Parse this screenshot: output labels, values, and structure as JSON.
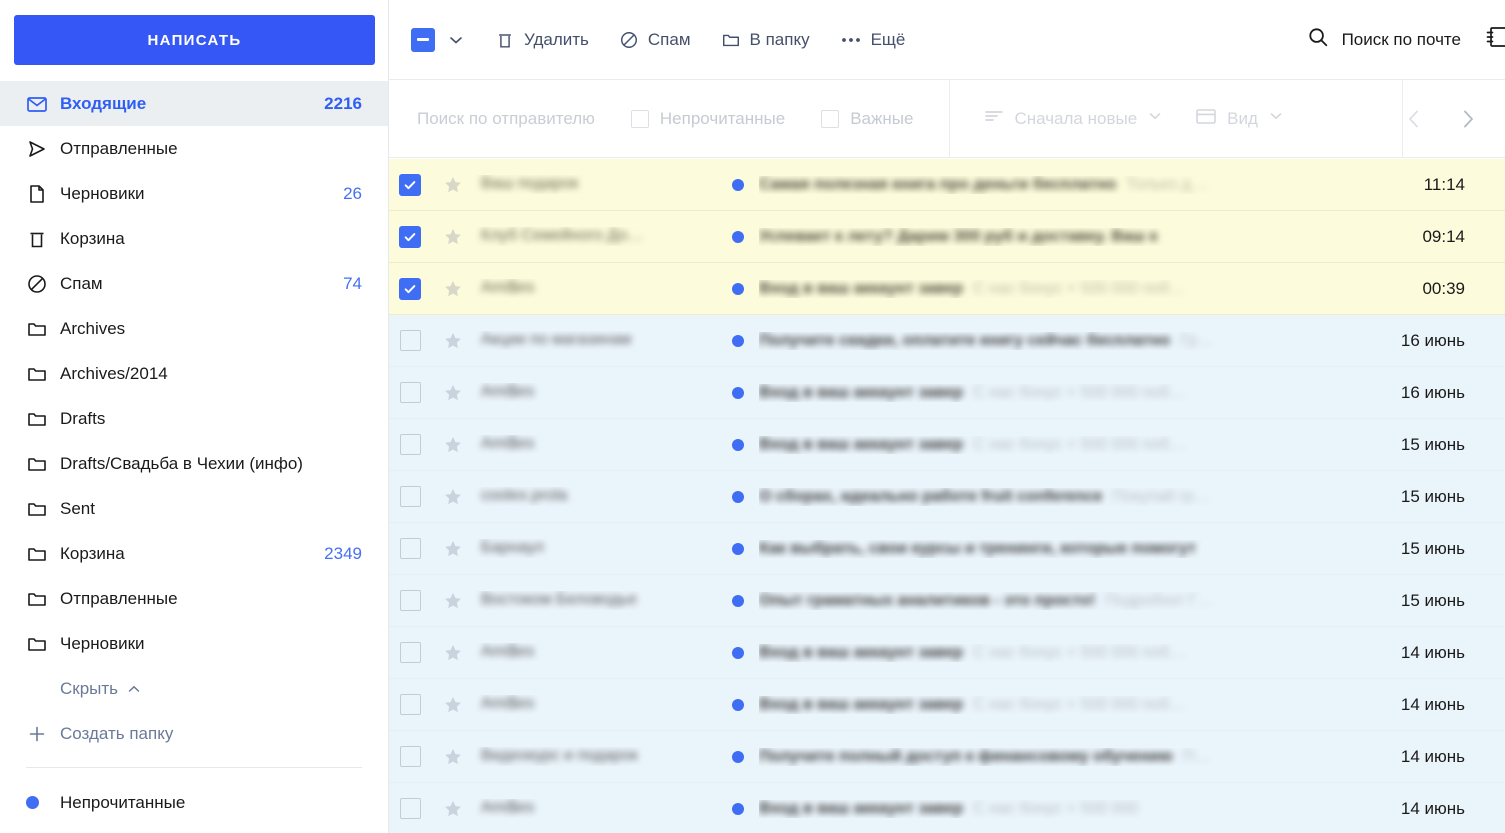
{
  "sidebar": {
    "compose_label": "НАПИСАТЬ",
    "items": [
      {
        "label": "Входящие",
        "count": "2216",
        "icon": "envelope-icon",
        "active": true
      },
      {
        "label": "Отправленные",
        "count": "",
        "icon": "send-icon",
        "active": false
      },
      {
        "label": "Черновики",
        "count": "26",
        "icon": "document-icon",
        "active": false
      },
      {
        "label": "Корзина",
        "count": "",
        "icon": "trash-icon",
        "active": false
      },
      {
        "label": "Спам",
        "count": "74",
        "icon": "block-icon",
        "active": false
      },
      {
        "label": "Archives",
        "count": "",
        "icon": "folder-icon",
        "active": false
      },
      {
        "label": "Archives/2014",
        "count": "",
        "icon": "folder-icon",
        "active": false
      },
      {
        "label": "Drafts",
        "count": "",
        "icon": "folder-icon",
        "active": false
      },
      {
        "label": "Drafts/Свадьба в Чехии (инфо)",
        "count": "",
        "icon": "folder-icon",
        "active": false
      },
      {
        "label": "Sent",
        "count": "",
        "icon": "folder-icon",
        "active": false
      },
      {
        "label": "Корзина",
        "count": "2349",
        "icon": "folder-icon",
        "active": false
      },
      {
        "label": "Отправленные",
        "count": "",
        "icon": "folder-icon",
        "active": false
      },
      {
        "label": "Черновики",
        "count": "",
        "icon": "folder-icon",
        "active": false
      }
    ],
    "hide_label": "Скрыть",
    "create_folder_label": "Создать папку",
    "unread_tag_label": "Непрочитанные"
  },
  "toolbar": {
    "delete_label": "Удалить",
    "spam_label": "Спам",
    "move_label": "В папку",
    "more_label": "Ещё",
    "search_label": "Поиск по почте"
  },
  "filterbar": {
    "sender_placeholder": "Поиск по отправителю",
    "unread_label": "Непрочитанные",
    "important_label": "Важные",
    "sort_label": "Сначала новые",
    "view_label": "Вид"
  },
  "colors": {
    "accent": "#3457f5",
    "link": "#4470f4",
    "selected_row": "#fcfbdc",
    "unread_row": "#eaf4fb",
    "active_nav": "#eceff1"
  },
  "messages": [
    {
      "selected": true,
      "unread": true,
      "from": "Ваш подарок",
      "subject": "Самая полезная книга про деньги бесплатно",
      "preview": "Только д…",
      "date": "11:14"
    },
    {
      "selected": true,
      "unread": true,
      "from": "Клуб Семейного До…",
      "subject": "Успевает к лету? Дарим 300 руб и доставку. Ваш к",
      "preview": "",
      "date": "09:14"
    },
    {
      "selected": true,
      "unread": true,
      "from": "Аmi$еs",
      "subject": "Вход в ваш аккаунт завер",
      "preview": "С нас бонус + 500 000 поб…",
      "date": "00:39"
    },
    {
      "selected": false,
      "unread": true,
      "from": "Акции по магазинам",
      "subject": "Получите скидки, оплатите книгу сейчас бесплатно",
      "preview": "Гр…",
      "date": "16 июнь"
    },
    {
      "selected": false,
      "unread": true,
      "from": "Аmi$еs",
      "subject": "Вход в ваш аккаунт завер",
      "preview": "С нас бонус + 500 000 поб…",
      "date": "16 июнь"
    },
    {
      "selected": false,
      "unread": true,
      "from": "Аmi$еs",
      "subject": "Вход в ваш аккаунт завер",
      "preview": "С нас бонус + 500 000 поб…",
      "date": "15 июнь"
    },
    {
      "selected": false,
      "unread": true,
      "from": "coolex.prola",
      "subject": "О сборах, идеально работе fruit conference",
      "preview": "Покупай гр…",
      "date": "15 июнь"
    },
    {
      "selected": false,
      "unread": true,
      "from": "Барнаул",
      "subject": "Как выбрать, свои курсы и тренинги, которые помогут",
      "preview": "",
      "date": "15 июнь"
    },
    {
      "selected": false,
      "unread": true,
      "from": "Востоком Беловодье",
      "subject": "Опыт граматных аналитиков - это просто!",
      "preview": "Подробно! Г…",
      "date": "15 июнь"
    },
    {
      "selected": false,
      "unread": true,
      "from": "Аmi$еs",
      "subject": "Вход в ваш аккаунт завер",
      "preview": "С нас бонус + 500 000 поб…",
      "date": "14 июнь"
    },
    {
      "selected": false,
      "unread": true,
      "from": "Аmi$еs",
      "subject": "Вход в ваш аккаунт завер",
      "preview": "С нас бонус + 500 000 поб…",
      "date": "14 июнь"
    },
    {
      "selected": false,
      "unread": true,
      "from": "Видеокурс и подарок",
      "subject": "Получите полный доступ к финансовому обучению",
      "preview": "П…",
      "date": "14 июнь"
    },
    {
      "selected": false,
      "unread": true,
      "from": "Аmi$еs",
      "subject": "Вход в ваш аккаунт завер",
      "preview": "С нас бонус + 500 000",
      "date": "14 июнь"
    }
  ]
}
